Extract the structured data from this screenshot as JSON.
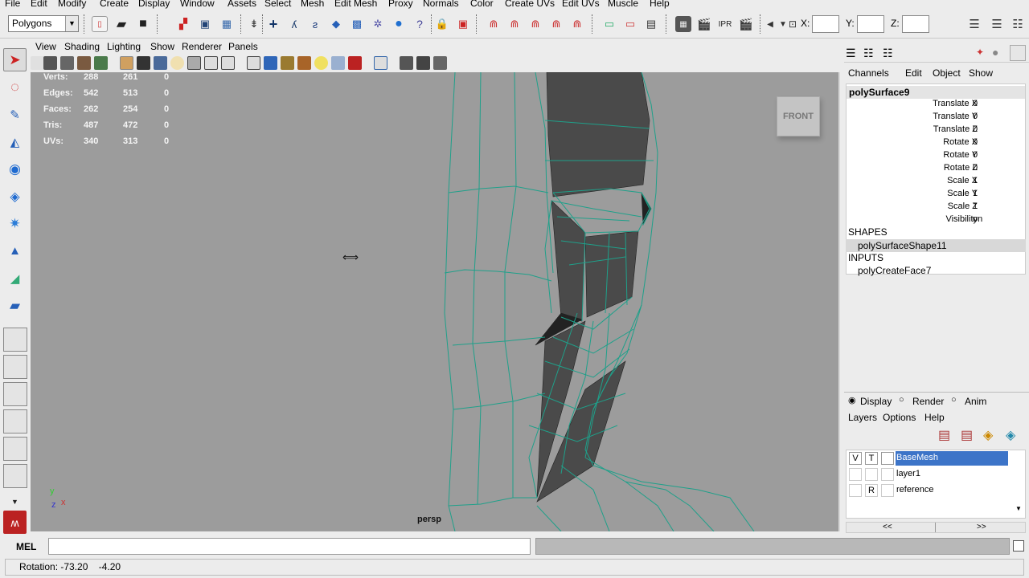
{
  "menu": [
    "File",
    "Edit",
    "Modify",
    "Create",
    "Display",
    "Window",
    "Assets",
    "Select",
    "Mesh",
    "Edit Mesh",
    "Proxy",
    "Normals",
    "Color",
    "Create UVs",
    "Edit UVs",
    "Muscle",
    "Help"
  ],
  "status_line": {
    "mode": "Polygons",
    "x_label": "X:",
    "y_label": "Y:",
    "z_label": "Z:"
  },
  "viewport_menu": [
    "View",
    "Shading",
    "Lighting",
    "Show",
    "Renderer",
    "Panels"
  ],
  "hud": {
    "rows": [
      {
        "label": "Verts:",
        "a": "288",
        "b": "261",
        "c": "0"
      },
      {
        "label": "Edges:",
        "a": "542",
        "b": "513",
        "c": "0"
      },
      {
        "label": "Faces:",
        "a": "262",
        "b": "254",
        "c": "0"
      },
      {
        "label": "Tris:",
        "a": "487",
        "b": "472",
        "c": "0"
      },
      {
        "label": "UVs:",
        "a": "340",
        "b": "313",
        "c": "0"
      }
    ],
    "camera": "persp",
    "viewcube": "FRONT",
    "axis_y": "y",
    "axis_z": "z",
    "axis_x": "x"
  },
  "channel_box": {
    "menu": [
      "Channels",
      "Edit",
      "Object",
      "Show"
    ],
    "object": "polySurface9",
    "attributes": [
      {
        "name": "Translate X",
        "value": "0"
      },
      {
        "name": "Translate Y",
        "value": "0"
      },
      {
        "name": "Translate Z",
        "value": "0"
      },
      {
        "name": "Rotate X",
        "value": "0"
      },
      {
        "name": "Rotate Y",
        "value": "0"
      },
      {
        "name": "Rotate Z",
        "value": "0"
      },
      {
        "name": "Scale X",
        "value": "1"
      },
      {
        "name": "Scale Y",
        "value": "1"
      },
      {
        "name": "Scale Z",
        "value": "1"
      },
      {
        "name": "Visibility",
        "value": "on"
      }
    ],
    "shapes_header": "SHAPES",
    "shape": "polySurfaceShape11",
    "inputs_header": "INPUTS",
    "input": "polyCreateFace7"
  },
  "layer_editor": {
    "tabs": [
      "Display",
      "Render",
      "Anim"
    ],
    "menu": [
      "Layers",
      "Options",
      "Help"
    ],
    "layers": [
      {
        "v": "V",
        "t": "T",
        "name": "BaseMesh",
        "selected": true
      },
      {
        "v": "",
        "t": "",
        "name": "layer1",
        "selected": false
      },
      {
        "v": "",
        "t": "R",
        "name": "reference",
        "selected": false
      }
    ],
    "scroll_left": "<<",
    "scroll_right": ">>"
  },
  "command_line": {
    "label": "MEL"
  },
  "help_line": {
    "text": "Rotation: -73.20    -4.20"
  },
  "colors": {
    "viewport_bg": "#9c9c9c",
    "wireframe": "#1fa08a",
    "selection": "#3c74c8"
  }
}
